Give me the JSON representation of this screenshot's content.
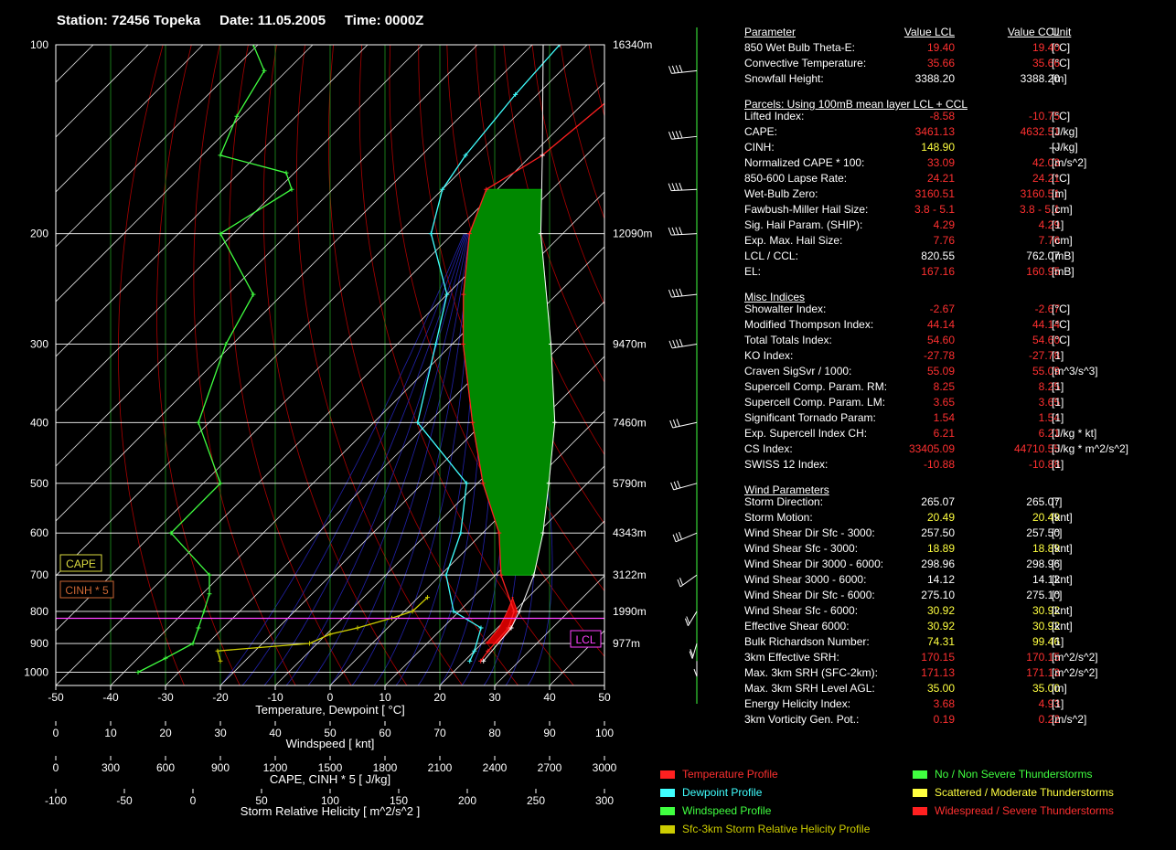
{
  "title": {
    "station": "Station: 72456 Topeka",
    "date": "Date: 11.05.2005",
    "time": "Time: 0000Z"
  },
  "colors": {
    "temperature": "#ff2020",
    "dewpoint": "#40ffff",
    "windspeed": "#40ff40",
    "helicity": "#cccc00",
    "cape_fill": "#008800",
    "cinh_fill": "#cc0000",
    "parcel": "#ffffff",
    "virtual": "#ff40ff",
    "lcl_box": "#ff40ff",
    "isobar": "#ffffff",
    "isotherm": "#22aa22",
    "dry_adiabat": "#aa0000",
    "moist_adiabat": "#2222aa",
    "value_red": "#ff3030",
    "value_yellow": "#ffff40",
    "value_white": "#ffffff"
  },
  "chart_data": {
    "type": "skew-t",
    "xlabel": "Temperature, Dewpoint  [ °C]",
    "xlim": [
      -50,
      50
    ],
    "x_ticks": [
      "-50",
      "-40",
      "-30",
      "-20",
      "-10",
      "0",
      "10",
      "20",
      "30",
      "40",
      "50"
    ],
    "pressure_levels": [
      100,
      200,
      300,
      400,
      500,
      600,
      700,
      800,
      900,
      1000
    ],
    "ylim": [
      100,
      1050
    ],
    "heights": [
      {
        "p": 100,
        "label": "16340m"
      },
      {
        "p": 200,
        "label": "12090m"
      },
      {
        "p": 300,
        "label": "9470m"
      },
      {
        "p": 400,
        "label": "7460m"
      },
      {
        "p": 500,
        "label": "5790m"
      },
      {
        "p": 600,
        "label": "4343m"
      },
      {
        "p": 700,
        "label": "3122m"
      },
      {
        "p": 800,
        "label": "1990m"
      },
      {
        "p": 900,
        "label": "977m"
      }
    ],
    "secondary_axes": [
      {
        "label": "Windspeed  [ knt]",
        "ticks": [
          "0",
          "10",
          "20",
          "30",
          "40",
          "50",
          "60",
          "70",
          "80",
          "90",
          "100"
        ]
      },
      {
        "label": "CAPE, CINH * 5  [ J/kg]",
        "ticks": [
          "0",
          "300",
          "600",
          "900",
          "1200",
          "1500",
          "1800",
          "2100",
          "2400",
          "2700",
          "3000"
        ]
      },
      {
        "label": "Storm Relative Helicity  [ m^2/s^2 ]",
        "ticks": [
          "-100",
          "-50",
          "0",
          "50",
          "100",
          "150",
          "200",
          "250",
          "300"
        ]
      }
    ],
    "series": [
      {
        "name": "Temperature Profile",
        "key": "temperature",
        "points": [
          [
            960,
            23
          ],
          [
            925,
            22.5
          ],
          [
            850,
            22
          ],
          [
            800,
            20
          ],
          [
            700,
            11
          ],
          [
            600,
            3
          ],
          [
            500,
            -9
          ],
          [
            400,
            -22
          ],
          [
            300,
            -38
          ],
          [
            250,
            -47
          ],
          [
            200,
            -57
          ],
          [
            170,
            -62
          ],
          [
            150,
            -58
          ],
          [
            100,
            -54
          ]
        ]
      },
      {
        "name": "Dewpoint Profile",
        "key": "dewpoint",
        "points": [
          [
            960,
            21
          ],
          [
            925,
            20
          ],
          [
            850,
            17
          ],
          [
            800,
            9
          ],
          [
            700,
            1
          ],
          [
            600,
            -4
          ],
          [
            500,
            -12
          ],
          [
            400,
            -32
          ],
          [
            300,
            -43
          ],
          [
            250,
            -50
          ],
          [
            200,
            -64
          ],
          [
            170,
            -70
          ],
          [
            150,
            -72
          ],
          [
            120,
            -74
          ],
          [
            100,
            -75
          ]
        ]
      },
      {
        "name": "Parcel",
        "key": "parcel",
        "points": [
          [
            960,
            23.5
          ],
          [
            850,
            22.5
          ],
          [
            800,
            21
          ],
          [
            700,
            17
          ],
          [
            600,
            11
          ],
          [
            500,
            3
          ],
          [
            400,
            -7
          ],
          [
            300,
            -22
          ],
          [
            200,
            -44
          ],
          [
            150,
            -58
          ],
          [
            100,
            -78
          ]
        ]
      },
      {
        "name": "Windspeed Profile",
        "key": "windspeed",
        "points": [
          [
            1000,
            15
          ],
          [
            950,
            20
          ],
          [
            900,
            25
          ],
          [
            850,
            26
          ],
          [
            800,
            27
          ],
          [
            750,
            28
          ],
          [
            700,
            28
          ],
          [
            600,
            21
          ],
          [
            500,
            30
          ],
          [
            400,
            26
          ],
          [
            300,
            31
          ],
          [
            250,
            36
          ],
          [
            200,
            30
          ],
          [
            170,
            43
          ],
          [
            160,
            42
          ],
          [
            150,
            30
          ],
          [
            130,
            33
          ],
          [
            110,
            38
          ],
          [
            100,
            36
          ]
        ]
      },
      {
        "name": "Sfc-3km Storm Relative Helicity Profile",
        "key": "helicity",
        "points": [
          [
            960,
            20
          ],
          [
            925,
            18
          ],
          [
            900,
            85
          ],
          [
            870,
            100
          ],
          [
            850,
            120
          ],
          [
            820,
            145
          ],
          [
            800,
            160
          ],
          [
            760,
            171
          ]
        ]
      }
    ],
    "annotations": [
      {
        "text": "CAPE",
        "p": 560,
        "t": -50
      },
      {
        "text": "CINH * 5",
        "p": 640,
        "t": -50
      },
      {
        "text": "LCL",
        "p": 820,
        "t": 50
      }
    ]
  },
  "table": {
    "header": {
      "label": "Parameter",
      "v1": "Value LCL",
      "v2": "Value CCL",
      "unit": "Unit"
    },
    "rows": [
      {
        "label": "850 Wet Bulb Theta-E:",
        "v1": "19.40",
        "v2": "19.40",
        "unit": "[°C]",
        "c": "red"
      },
      {
        "label": "Convective Temperature:",
        "v1": "35.66",
        "v2": "35.66",
        "unit": "[°C]",
        "c": "red"
      },
      {
        "label": "Snowfall Height:",
        "v1": "3388.20",
        "v2": "3388.20",
        "unit": "[m]",
        "c": "white"
      },
      {
        "section": "Parcels: Using 100mB mean layer LCL + CCL"
      },
      {
        "label": "Lifted Index:",
        "v1": "-8.58",
        "v2": "-10.75",
        "unit": "[°C]",
        "c": "red"
      },
      {
        "label": "CAPE:",
        "v1": "3461.13",
        "v2": "4632.51",
        "unit": "[J/kg]",
        "c": "red"
      },
      {
        "label": "CINH:",
        "v1": "148.90",
        "v2": "---",
        "unit": "[J/kg]",
        "c": "yellow",
        "c2": "white"
      },
      {
        "label": "Normalized CAPE * 100:",
        "v1": "33.09",
        "v2": "42.03",
        "unit": "[m/s^2]",
        "c": "red"
      },
      {
        "label": "850-600 Lapse Rate:",
        "v1": "24.21",
        "v2": "24.21",
        "unit": "[°C]",
        "c": "red"
      },
      {
        "label": "Wet-Bulb Zero:",
        "v1": "3160.51",
        "v2": "3160.51",
        "unit": "[m]",
        "c": "red"
      },
      {
        "label": "Fawbush-Miller Hail Size:",
        "v1": "3.8 - 5.1",
        "v2": "3.8 - 5.1",
        "unit": "[cm]",
        "c": "red"
      },
      {
        "label": "Sig. Hail Param. (SHIP):",
        "v1": "4.29",
        "v2": "4.29",
        "unit": "[1]",
        "c": "red"
      },
      {
        "label": "Exp. Max. Hail Size:",
        "v1": "7.76",
        "v2": "7.76",
        "unit": "[cm]",
        "c": "red"
      },
      {
        "label": "LCL / CCL:",
        "v1": "820.55",
        "v2": "762.07",
        "unit": "[mB]",
        "c": "white"
      },
      {
        "label": "EL:",
        "v1": "167.16",
        "v2": "160.95",
        "unit": "[mB]",
        "c": "red"
      },
      {
        "section": "Misc Indices"
      },
      {
        "label": "Showalter Index:",
        "v1": "-2.67",
        "v2": "-2.67",
        "unit": "[°C]",
        "c": "red"
      },
      {
        "label": "Modified Thompson Index:",
        "v1": "44.14",
        "v2": "44.14",
        "unit": "[°C]",
        "c": "red"
      },
      {
        "label": "Total Totals Index:",
        "v1": "54.60",
        "v2": "54.60",
        "unit": "[°C]",
        "c": "red"
      },
      {
        "label": "KO Index:",
        "v1": "-27.78",
        "v2": "-27.78",
        "unit": "[1]",
        "c": "red"
      },
      {
        "label": "Craven SigSvr / 1000:",
        "v1": "55.09",
        "v2": "55.09",
        "unit": "[m^3/s^3]",
        "c": "red"
      },
      {
        "label": "Supercell Comp. Param. RM:",
        "v1": "8.25",
        "v2": "8.25",
        "unit": "[1]",
        "c": "red"
      },
      {
        "label": "Supercell Comp. Param. LM:",
        "v1": "3.65",
        "v2": "3.65",
        "unit": "[1]",
        "c": "red"
      },
      {
        "label": "Significant Tornado Param:",
        "v1": "1.54",
        "v2": "1.54",
        "unit": "[1]",
        "c": "red"
      },
      {
        "label": "Exp. Supercell Index CH:",
        "v1": "6.21",
        "v2": "6.21",
        "unit": "[J/kg * kt]",
        "c": "red"
      },
      {
        "label": "CS Index:",
        "v1": "33405.09",
        "v2": "44710.55",
        "unit": "[J/kg * m^2/s^2]",
        "c": "red"
      },
      {
        "label": "SWISS 12 Index:",
        "v1": "-10.88",
        "v2": "-10.88",
        "unit": "[1]",
        "c": "red"
      },
      {
        "section": "Wind Parameters"
      },
      {
        "label": "Storm Direction:",
        "v1": "265.07",
        "v2": "265.07",
        "unit": "[°]",
        "c": "white"
      },
      {
        "label": "Storm Motion:",
        "v1": "20.49",
        "v2": "20.49",
        "unit": "[knt]",
        "c": "yellow"
      },
      {
        "label": "Wind Shear Dir Sfc - 3000:",
        "v1": "257.50",
        "v2": "257.50",
        "unit": "[°]",
        "c": "white"
      },
      {
        "label": "Wind Shear Sfc - 3000:",
        "v1": "18.89",
        "v2": "18.89",
        "unit": "[knt]",
        "c": "yellow"
      },
      {
        "label": "Wind Shear Dir 3000 - 6000:",
        "v1": "298.96",
        "v2": "298.96",
        "unit": "[°]",
        "c": "white"
      },
      {
        "label": "Wind Shear 3000 - 6000:",
        "v1": "14.12",
        "v2": "14.12",
        "unit": "[knt]",
        "c": "white"
      },
      {
        "label": "Wind Shear Dir Sfc - 6000:",
        "v1": "275.10",
        "v2": "275.10",
        "unit": "[°]",
        "c": "white"
      },
      {
        "label": "Wind Shear Sfc - 6000:",
        "v1": "30.92",
        "v2": "30.92",
        "unit": "[knt]",
        "c": "yellow"
      },
      {
        "label": "Effective Shear 6000:",
        "v1": "30.92",
        "v2": "30.92",
        "unit": "[knt]",
        "c": "yellow"
      },
      {
        "label": "Bulk Richardson Number:",
        "v1": "74.31",
        "v2": "99.46",
        "unit": "[1]",
        "c": "yellow"
      },
      {
        "label": "3km Effective SRH:",
        "v1": "170.15",
        "v2": "170.15",
        "unit": "[m^2/s^2]",
        "c": "red"
      },
      {
        "label": "Max. 3km SRH (SFC-2km):",
        "v1": "171.13",
        "v2": "171.13",
        "unit": "[m^2/s^2]",
        "c": "red"
      },
      {
        "label": "Max. 3km SRH Level AGL:",
        "v1": "35.00",
        "v2": "35.00",
        "unit": "[m]",
        "c": "yellow"
      },
      {
        "label": "Energy Helicity Index:",
        "v1": "3.68",
        "v2": "4.93",
        "unit": "[1]",
        "c": "red"
      },
      {
        "label": "3km Vorticity Gen. Pot.:",
        "v1": "0.19",
        "v2": "0.22",
        "unit": "[m/s^2]",
        "c": "red"
      }
    ]
  },
  "legend": {
    "profiles": [
      {
        "label": "Temperature Profile",
        "color": "#ff2020",
        "text": "#ff3030"
      },
      {
        "label": "Dewpoint Profile",
        "color": "#40ffff",
        "text": "#40ffff"
      },
      {
        "label": "Windspeed Profile",
        "color": "#40ff40",
        "text": "#40ff40"
      },
      {
        "label": "Sfc-3km Storm Relative Helicity Profile",
        "color": "#cccc00",
        "text": "#cccc00"
      }
    ],
    "categories": [
      {
        "label": "No / Non Severe Thunderstorms",
        "color": "#40ff40",
        "text": "#40ff40"
      },
      {
        "label": "Scattered / Moderate Thunderstorms",
        "color": "#ffff40",
        "text": "#ffff40"
      },
      {
        "label": "Widespread / Severe Thunderstorms",
        "color": "#ff2020",
        "text": "#ff3030"
      }
    ]
  },
  "wind_barbs": [
    {
      "p": 110,
      "dir": 260,
      "spd": 50
    },
    {
      "p": 140,
      "dir": 260,
      "spd": 55
    },
    {
      "p": 170,
      "dir": 265,
      "spd": 60
    },
    {
      "p": 200,
      "dir": 265,
      "spd": 60
    },
    {
      "p": 250,
      "dir": 260,
      "spd": 50
    },
    {
      "p": 300,
      "dir": 255,
      "spd": 45
    },
    {
      "p": 400,
      "dir": 250,
      "spd": 40
    },
    {
      "p": 500,
      "dir": 245,
      "spd": 35
    },
    {
      "p": 600,
      "dir": 235,
      "spd": 30
    },
    {
      "p": 700,
      "dir": 220,
      "spd": 25
    },
    {
      "p": 800,
      "dir": 200,
      "spd": 25
    },
    {
      "p": 900,
      "dir": 190,
      "spd": 20
    },
    {
      "p": 960,
      "dir": 180,
      "spd": 15
    }
  ]
}
